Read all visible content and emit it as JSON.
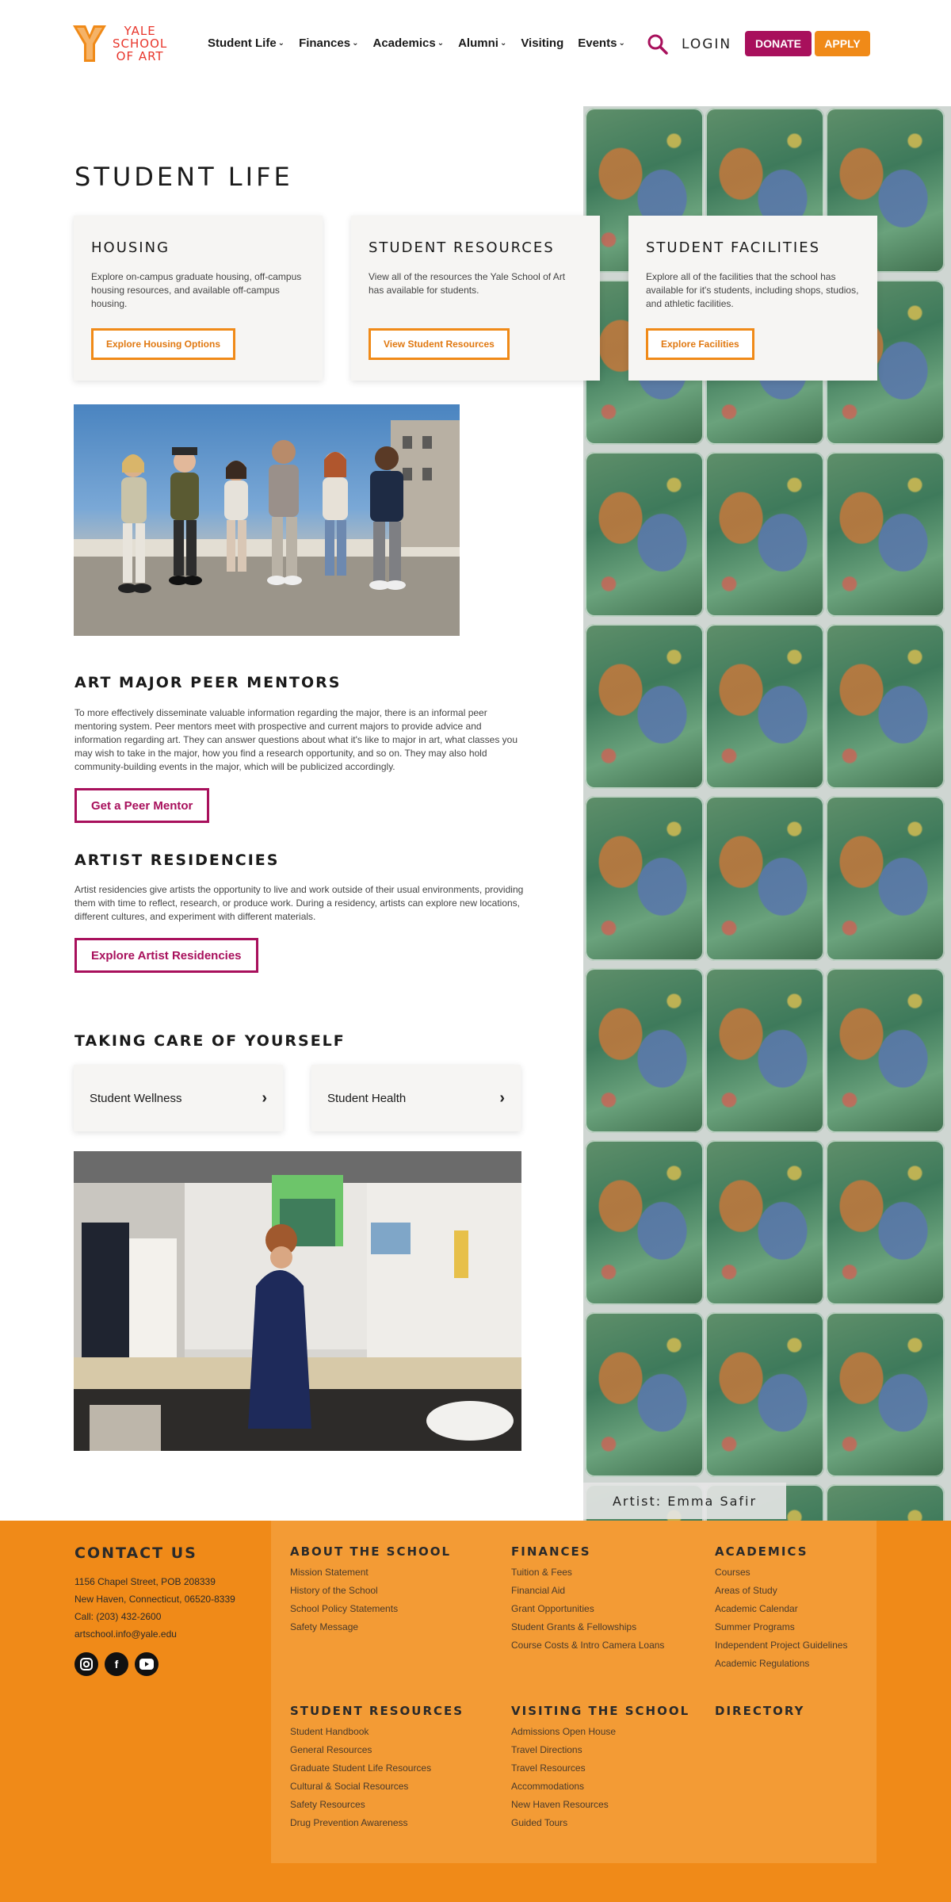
{
  "header": {
    "logo_line1": "YALE",
    "logo_line2": "SCHOOL",
    "logo_line3": "OF ART",
    "nav": [
      {
        "label": "Student Life",
        "has_dropdown": true
      },
      {
        "label": "Finances",
        "has_dropdown": true
      },
      {
        "label": "Academics",
        "has_dropdown": true
      },
      {
        "label": "Alumni",
        "has_dropdown": true
      },
      {
        "label": "Visiting",
        "has_dropdown": false
      },
      {
        "label": "Events",
        "has_dropdown": true
      }
    ],
    "search_icon": "search-icon",
    "login_label": "LOGIN",
    "donate_label": "DONATE",
    "apply_label": "APPLY"
  },
  "page_title": "STUDENT LIFE",
  "cards": [
    {
      "title": "HOUSING",
      "description": "Explore on-campus graduate housing, off-campus housing resources, and available off-campus housing.",
      "button": "Explore Housing Options"
    },
    {
      "title": "STUDENT RESOURCES",
      "description": "View all of the resources the Yale School of Art has available for students.",
      "button": "View Student Resources"
    },
    {
      "title": "STUDENT FACILITIES",
      "description": "Explore all of the facilities that the school has available for it's students, including shops, studios, and athletic facilities.",
      "button": "Explore Facilities"
    }
  ],
  "peer_mentors": {
    "heading": "ART MAJOR PEER MENTORS",
    "body": "To more effectively disseminate valuable information regarding the major, there is an informal peer mentoring system. Peer mentors meet with prospective and current majors to provide advice and information regarding art. They can answer questions about what it's like to major in art, what classes you may wish to take in the major, how you find a research opportunity, and so on. They may also hold community-building events in the major, which will be publicized accordingly.",
    "button": "Get a Peer Mentor"
  },
  "residencies": {
    "heading": "ARTIST RESIDENCIES",
    "body": "Artist residencies give artists the opportunity to live and work outside of their usual environments, providing them with time to reflect, research, or produce work. During a residency, artists can explore new locations, different cultures, and experiment with different materials.",
    "button": "Explore Artist Residencies"
  },
  "care": {
    "heading": "TAKING CARE OF YOURSELF",
    "items": [
      "Student Wellness",
      "Student Health"
    ]
  },
  "art_caption": "Artist: Emma Safir",
  "footer": {
    "contact_title": "CONTACT US",
    "address1": "1156 Chapel Street, POB 208339",
    "address2": "New Haven, Connecticut, 06520-8339",
    "phone": "Call: (203) 432-2600",
    "email": "artschool.info@yale.edu",
    "social": [
      "instagram-icon",
      "facebook-icon",
      "youtube-icon"
    ],
    "columns": [
      {
        "title": "ABOUT THE SCHOOL",
        "links": [
          "Mission Statement",
          "History of the School",
          "School Policy Statements",
          "Safety Message"
        ]
      },
      {
        "title": "FINANCES",
        "links": [
          "Tuition & Fees",
          "Financial Aid",
          "Grant Opportunities",
          "Student Grants & Fellowships",
          "Course Costs & Intro Camera Loans"
        ]
      },
      {
        "title": "ACADEMICS",
        "links": [
          "Courses",
          "Areas of Study",
          "Academic Calendar",
          "Summer Programs",
          "Independent Project Guidelines",
          "Academic Regulations"
        ]
      },
      {
        "title": "STUDENT RESOURCES",
        "links": [
          "Student Handbook",
          "General Resources",
          "Graduate Student Life Resources",
          "Cultural & Social Resources",
          "Safety Resources",
          "Drug Prevention Awareness"
        ]
      },
      {
        "title": "VISITING THE SCHOOL",
        "links": [
          "Admissions Open House",
          "Travel Directions",
          "Travel Resources",
          "Accommodations",
          "New Haven Resources",
          "Guided Tours"
        ]
      },
      {
        "title": "DIRECTORY",
        "links": []
      }
    ]
  },
  "colors": {
    "brand_red": "#e8362c",
    "magenta": "#a8105c",
    "orange": "#f08a18"
  }
}
